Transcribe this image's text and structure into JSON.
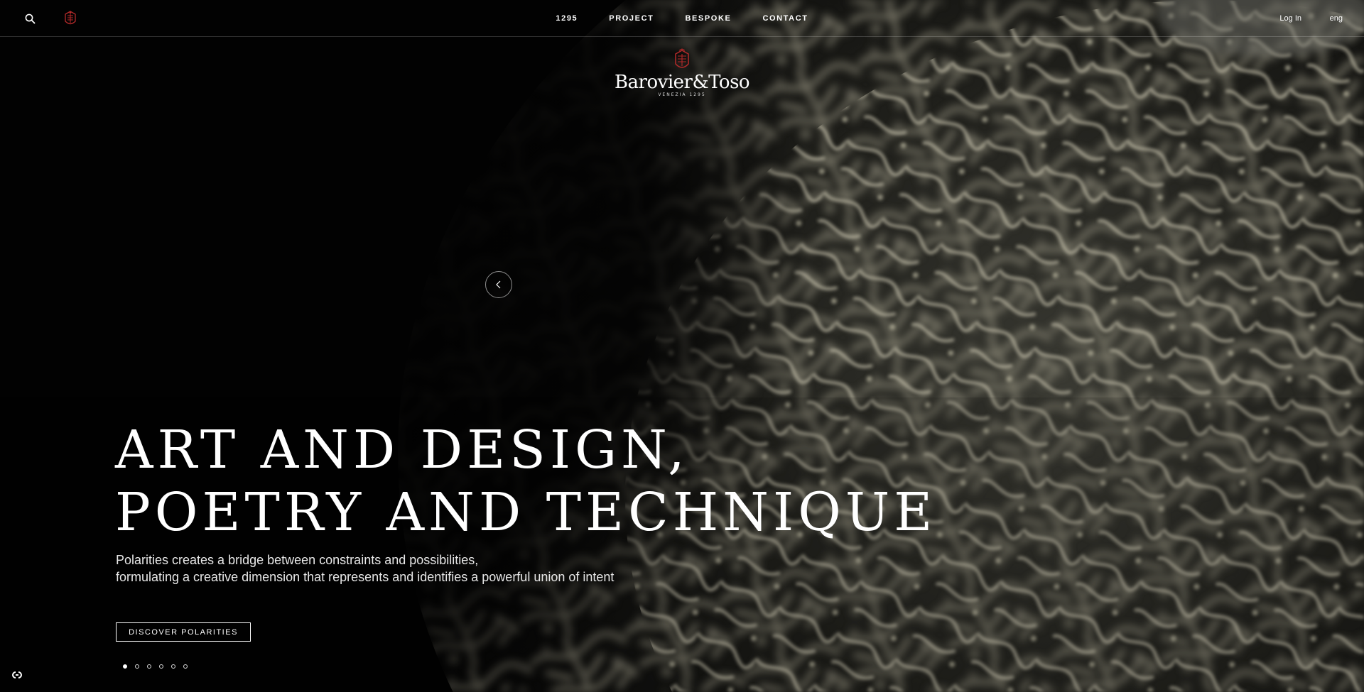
{
  "header": {
    "nav": [
      {
        "label": "1295"
      },
      {
        "label": "PROJECT"
      },
      {
        "label": "BESPOKE"
      },
      {
        "label": "CONTACT"
      }
    ],
    "login_label": "Log In",
    "language_label": "eng"
  },
  "brand": {
    "wordmark": "Barovier&Toso",
    "tagline": "VENEZIA 1295",
    "crest_color": "#b52a2a"
  },
  "hero": {
    "headline_line1": "ART AND DESIGN,",
    "headline_line2": "POETRY AND TECHNIQUE",
    "subtext_line1": "Polarities creates a bridge between constraints and possibilities,",
    "subtext_line2": "formulating a creative dimension that represents and identifies a powerful union of intent",
    "cta_label": "DISCOVER POLARITIES",
    "slide_count": 6,
    "active_slide": 1
  },
  "icons": {
    "search": "search-icon",
    "crest": "crest-icon",
    "prev": "chevron-left-icon",
    "corner": "accessibility-icon"
  }
}
